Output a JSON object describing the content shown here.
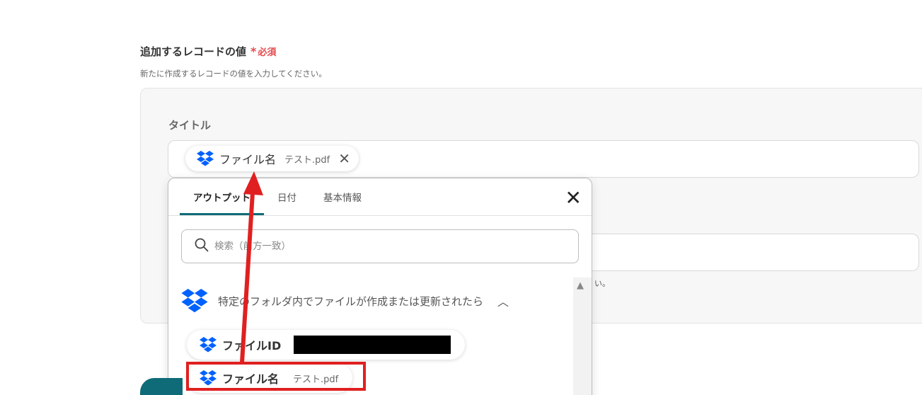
{
  "section": {
    "title": "追加するレコードの値",
    "required_star": "*",
    "required_label": "必須",
    "description": "新たに作成するレコードの値を入力してください。"
  },
  "field": {
    "label": "タイトル",
    "chip": {
      "name": "ファイル名",
      "value": "テスト.pdf",
      "close": "✕"
    },
    "tail_text": "い。"
  },
  "popup": {
    "tabs": [
      {
        "label": "アウトプット"
      },
      {
        "label": "日付"
      },
      {
        "label": "基本情報"
      }
    ],
    "close": "✕",
    "search_placeholder": "検索（前方一致）",
    "group": {
      "title": "特定のフォルダ内でファイルが作成または更新されたら",
      "chevron": "︿"
    },
    "items": [
      {
        "name": "ファイルID",
        "value": ""
      },
      {
        "name": "ファイル名",
        "value": "テスト.pdf"
      }
    ]
  },
  "colors": {
    "dropbox": "#0061fe",
    "accent": "#0f6b78",
    "annotation": "#e02020",
    "required": "#e5484d"
  }
}
